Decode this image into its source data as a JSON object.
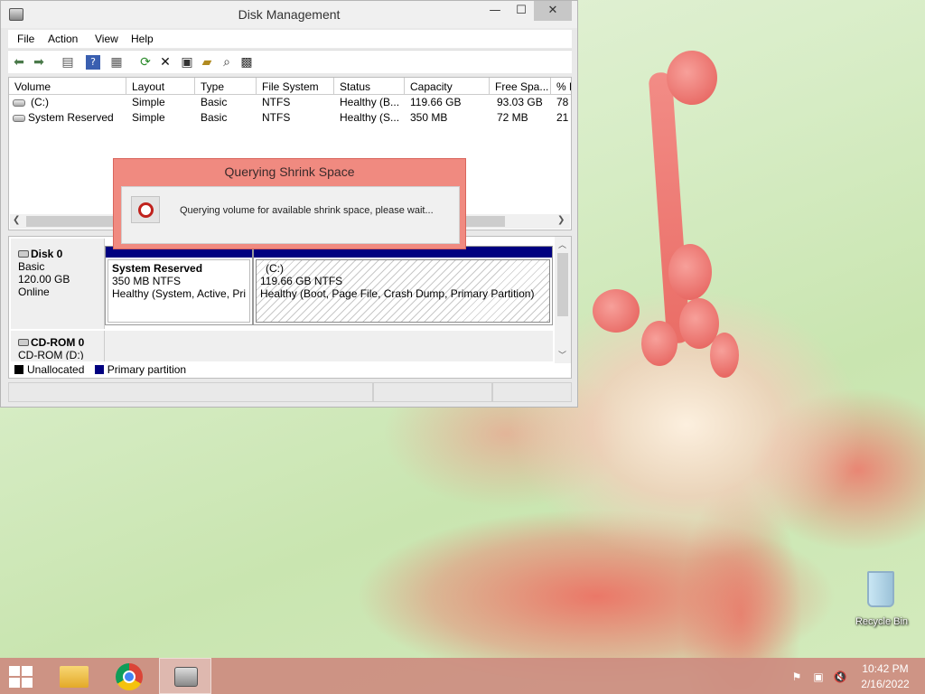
{
  "window": {
    "title": "Disk Management",
    "minimize": "—",
    "maximize": "☐",
    "close": "✕"
  },
  "menu": [
    "File",
    "Action",
    "View",
    "Help"
  ],
  "toolbar": {
    "icons": [
      "back-icon",
      "forward-icon",
      "properties-icon",
      "help-icon",
      "console-tree-icon",
      "refresh-icon",
      "delete-icon",
      "properties-sheet-icon",
      "open-icon",
      "search-icon",
      "help-topics-icon"
    ]
  },
  "volume_table": {
    "columns": [
      "Volume",
      "Layout",
      "Type",
      "File System",
      "Status",
      "Capacity",
      "Free Spa...",
      "% F"
    ],
    "rows": [
      [
        "(C:)",
        "Simple",
        "Basic",
        "NTFS",
        "Healthy (B...",
        "119.66 GB",
        "93.03 GB",
        "78"
      ],
      [
        "System Reserved",
        "Simple",
        "Basic",
        "NTFS",
        "Healthy (S...",
        "350 MB",
        "72 MB",
        "21"
      ]
    ]
  },
  "disks": [
    {
      "name": "Disk 0",
      "type": "Basic",
      "size": "120.00 GB",
      "state": "Online",
      "partitions": [
        {
          "name": "System Reserved",
          "fs": "350 MB NTFS",
          "status": "Healthy (System, Active, Prir"
        },
        {
          "name": "(C:)",
          "fs": "119.66 GB NTFS",
          "status": "Healthy (Boot, Page File, Crash Dump, Primary Partition)"
        }
      ]
    },
    {
      "name": "CD-ROM 0",
      "type": "CD-ROM (D:)"
    }
  ],
  "legend": [
    {
      "label": "Unallocated",
      "color": "#000000"
    },
    {
      "label": "Primary partition",
      "color": "#000080"
    }
  ],
  "dialog": {
    "title": "Querying Shrink Space",
    "message": "Querying volume for available shrink space, please wait..."
  },
  "desktop": {
    "recycle_bin": "Recycle Bin"
  },
  "taskbar": {
    "time": "10:42 PM",
    "date": "2/16/2022"
  },
  "colors": {
    "dialog_frame": "#f08a80",
    "partition_header": "#000080",
    "taskbar": "#cd8c80"
  }
}
